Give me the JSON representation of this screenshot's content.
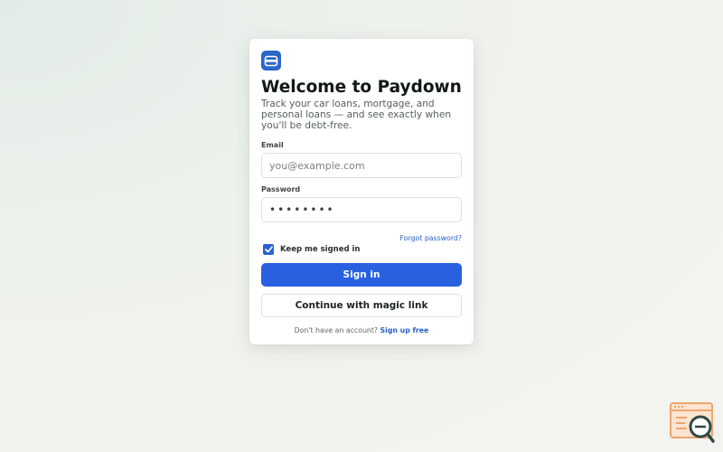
{
  "app": {
    "title": "Welcome to Paydown",
    "subtitle": "Track your car loans, mortgage, and personal loans — and see exactly when you'll be debt-free.",
    "logo_icon": "car-icon",
    "accent_color": "#2860e0"
  },
  "form": {
    "email_label": "Email",
    "email_placeholder": "you@example.com",
    "email_value": "",
    "password_label": "Password",
    "password_value": "••••••••",
    "forgot_label": "Forgot password?",
    "remember_label": "Keep me signed in",
    "remember_checked": true,
    "sign_in_label": "Sign in",
    "magic_link_label": "Continue with magic link"
  },
  "signup": {
    "prompt": "Don't have an account?",
    "link_label": "Sign up free"
  },
  "corner_badge_icon": "search-icon"
}
